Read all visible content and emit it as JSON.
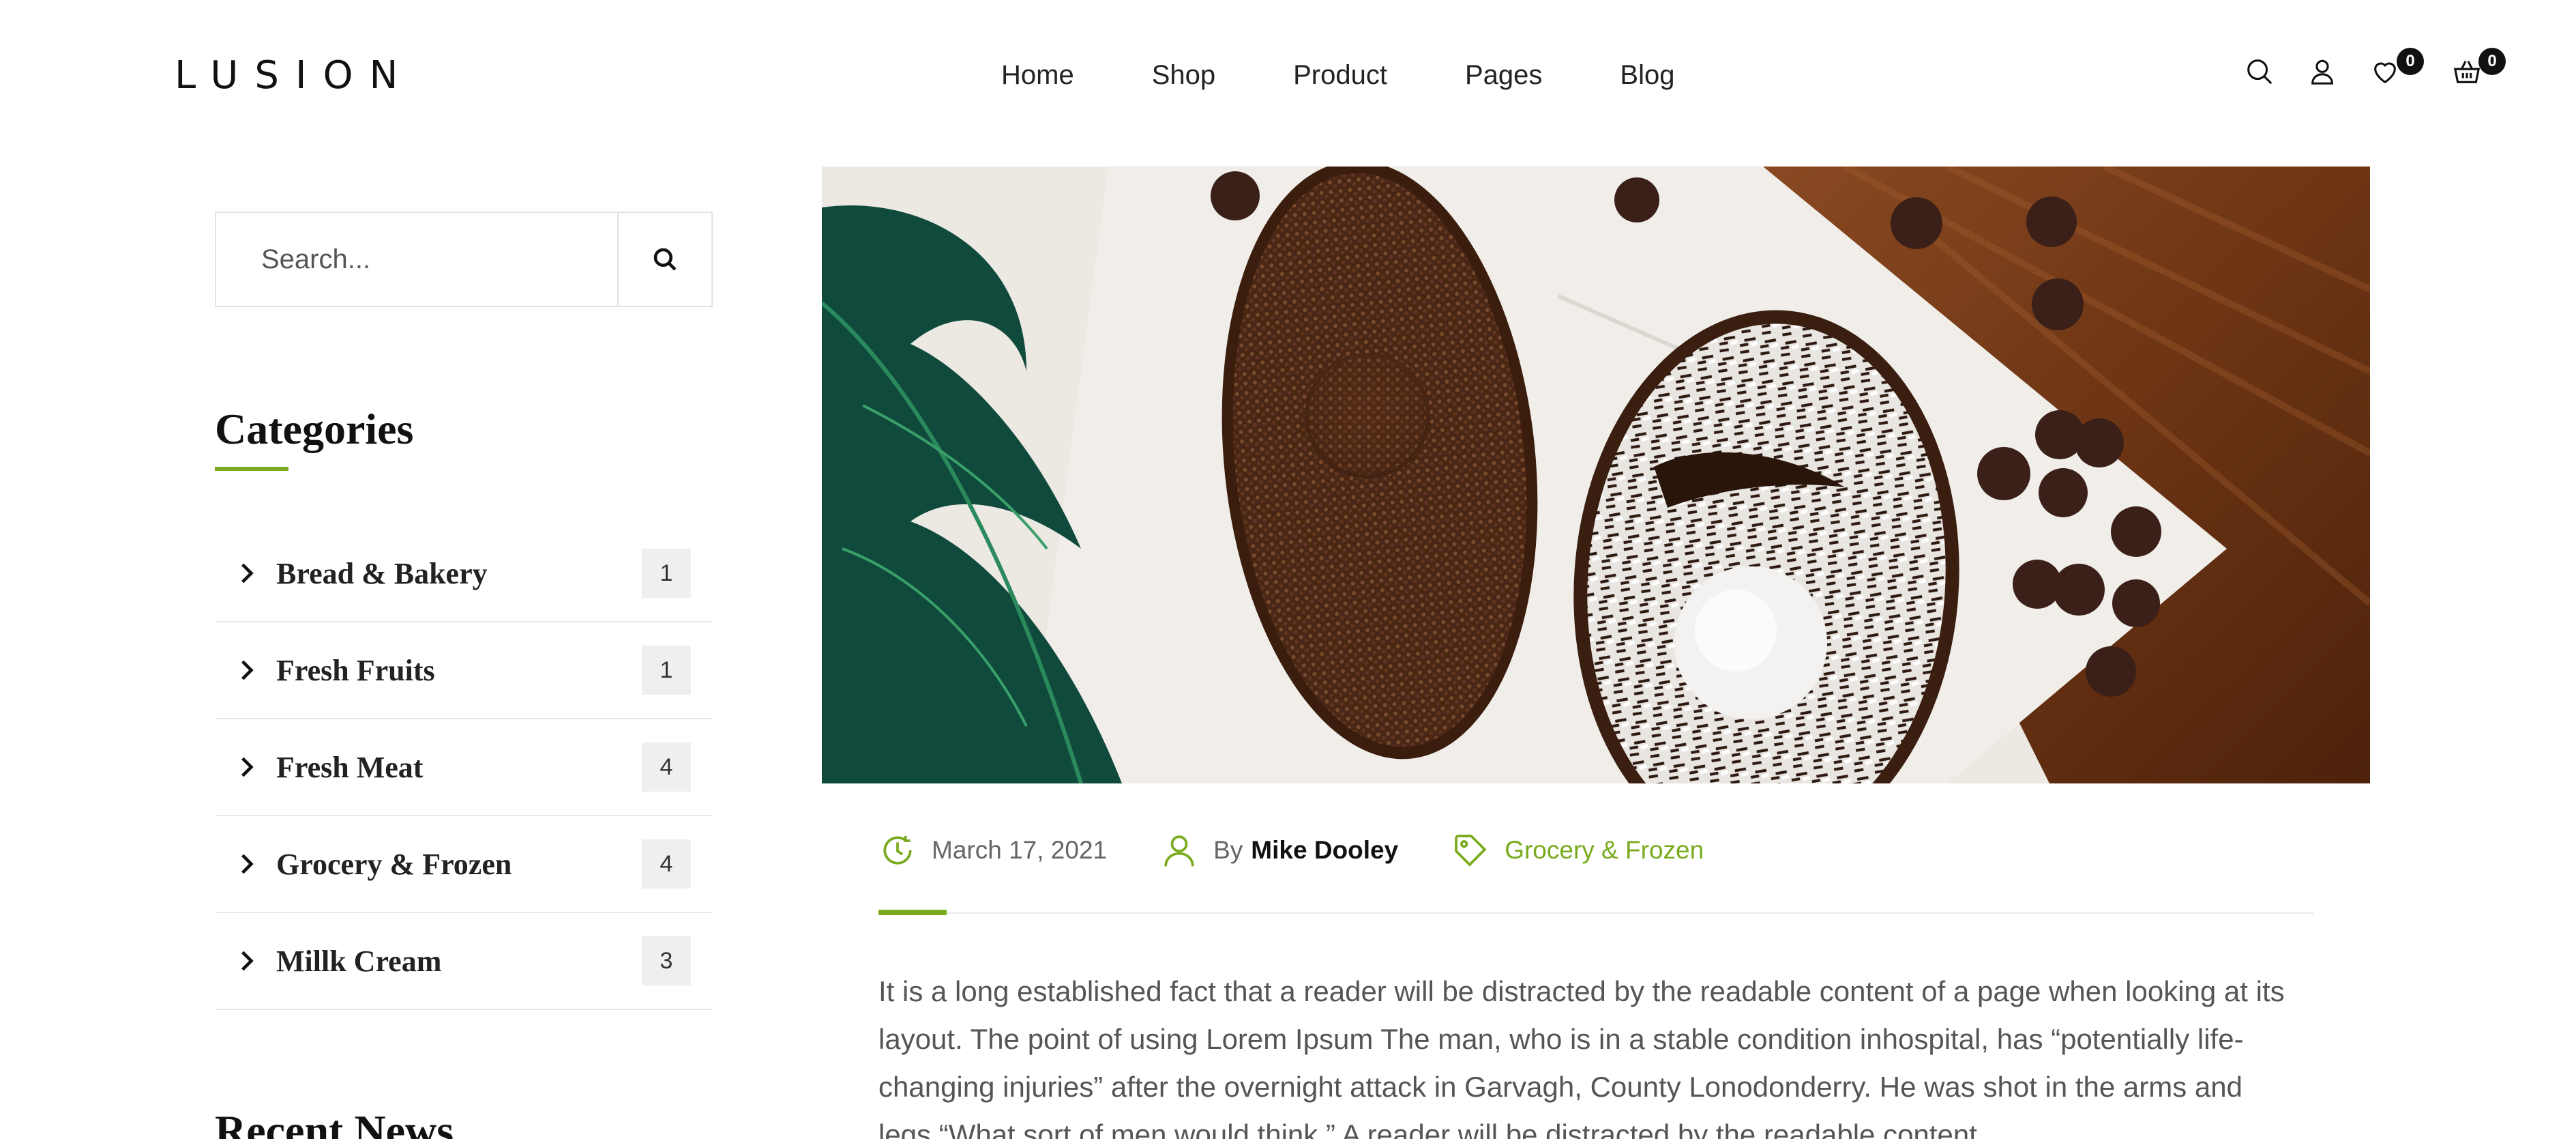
{
  "header": {
    "logo": "LUSION",
    "nav": [
      "Home",
      "Shop",
      "Product",
      "Pages",
      "Blog"
    ],
    "wishlist_count": "0",
    "cart_count": "0"
  },
  "sidebar": {
    "search": {
      "placeholder": "Search..."
    },
    "categories_title": "Categories",
    "categories": [
      {
        "name": "Bread & Bakery",
        "count": "1"
      },
      {
        "name": "Fresh Fruits",
        "count": "1"
      },
      {
        "name": "Fresh Meat",
        "count": "4"
      },
      {
        "name": "Grocery & Frozen",
        "count": "4"
      },
      {
        "name": "Millk Cream",
        "count": "3"
      }
    ],
    "recent_news_title": "Recent News"
  },
  "post": {
    "date": "March 17, 2021",
    "by_label": "By",
    "author": "Mike Dooley",
    "category": "Grocery & Frozen",
    "body": "It is a long established fact that a reader will be distracted by the readable content of a page when looking at its layout. The point of using Lorem Ipsum The man, who is in a stable condition inhospital, has “potentially life-changing injuries” after the overnight attack in Garvagh, County Lonodonderry. He was shot in the arms and legs.“What sort of men would think,” A reader will be distracted by the readable content"
  },
  "colors": {
    "accent": "#7aab1e",
    "text": "#222222",
    "muted": "#666666"
  },
  "icons": [
    "search-icon",
    "user-icon",
    "heart-icon",
    "basket-icon",
    "chevron-right-icon",
    "clock-icon",
    "tag-icon"
  ]
}
